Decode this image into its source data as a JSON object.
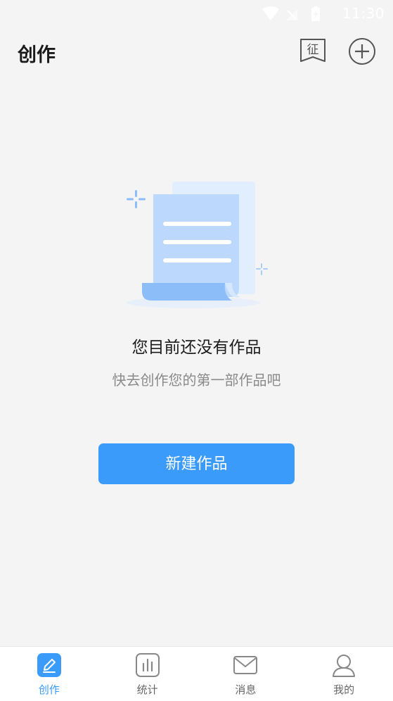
{
  "status_bar": {
    "time": "11:30",
    "icons": [
      "wifi-icon",
      "signal-icon",
      "battery-icon"
    ]
  },
  "header": {
    "title": "创作",
    "contest_button": {
      "icon": "contest-flag-icon",
      "glyph": "征"
    },
    "add_button": {
      "icon": "plus-circle-icon"
    }
  },
  "empty_state": {
    "illustration": "document-scroll-illustration",
    "title": "您目前还没有作品",
    "subtitle": "快去创作您的第一部作品吧"
  },
  "primary_action": {
    "label": "新建作品"
  },
  "tab_bar": {
    "items": [
      {
        "label": "创作",
        "icon": "pen-icon",
        "active": true
      },
      {
        "label": "统计",
        "icon": "bar-chart-icon",
        "active": false
      },
      {
        "label": "消息",
        "icon": "envelope-icon",
        "active": false
      },
      {
        "label": "我的",
        "icon": "user-icon",
        "active": false
      }
    ]
  },
  "colors": {
    "accent": "#3a9bfb",
    "background": "#f4f4f4",
    "illustration_light": "#dcebfe",
    "illustration_mid": "#bcd9fd",
    "illustration_dark": "#8cbdf8"
  }
}
